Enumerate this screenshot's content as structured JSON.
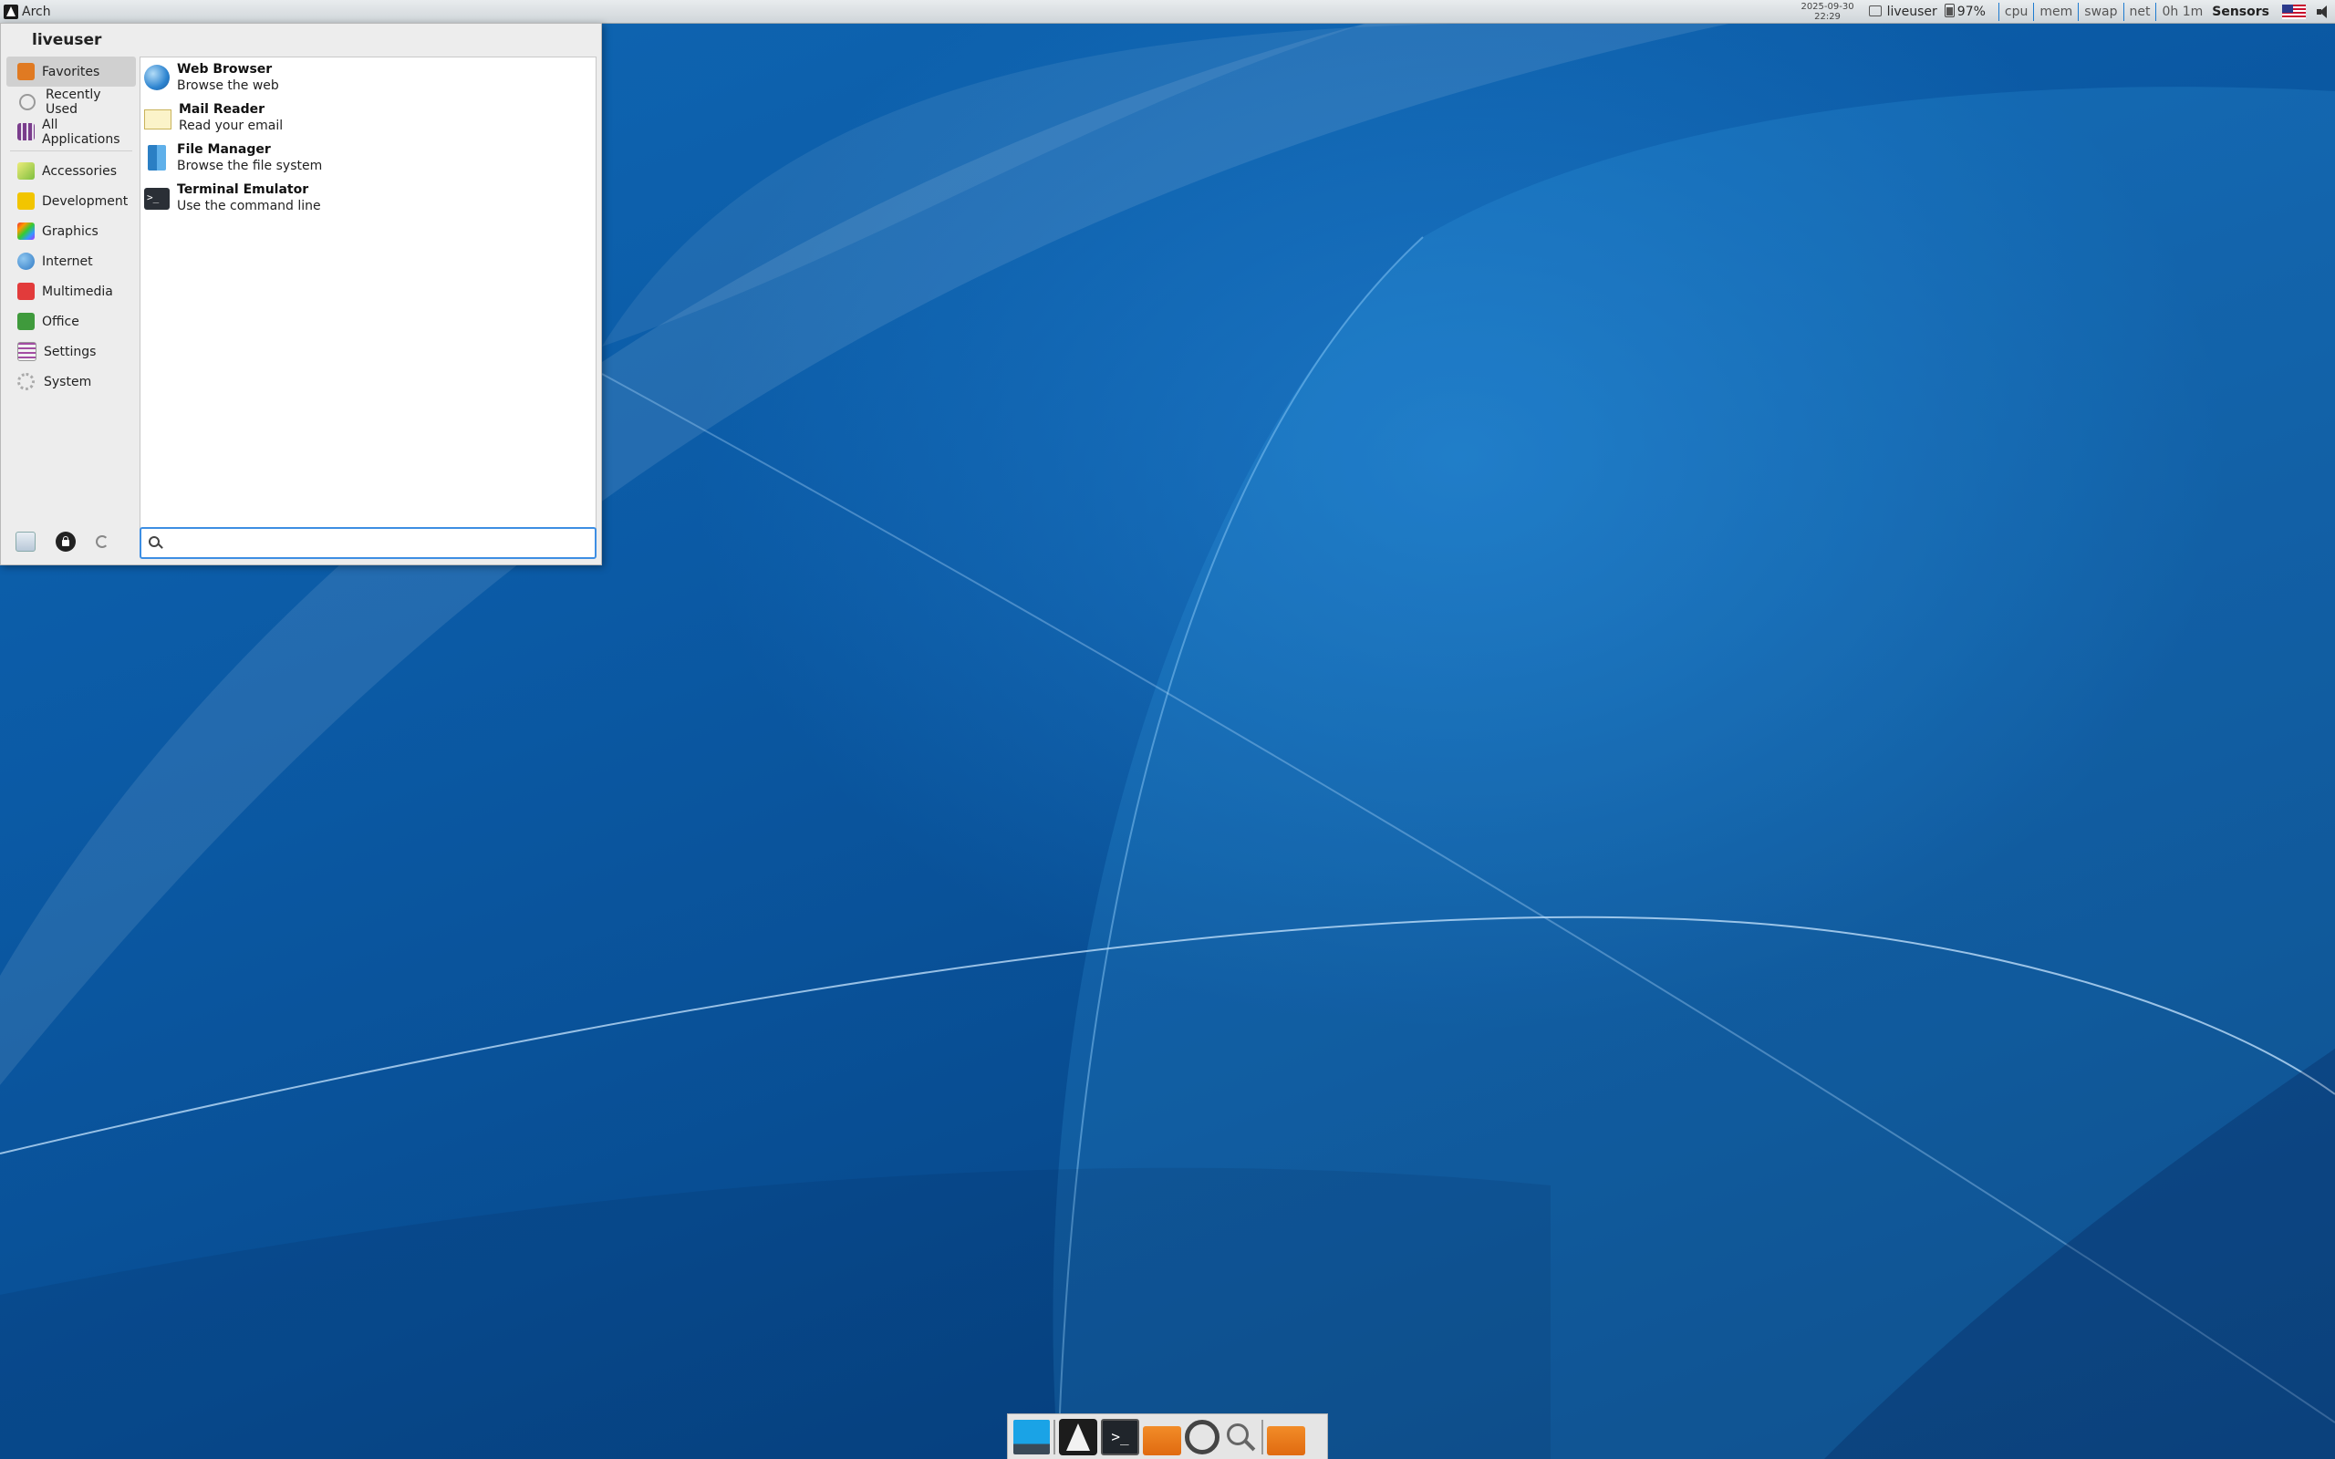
{
  "top_panel": {
    "menu_label": "Arch",
    "clock_date": "2025-09-30",
    "clock_time": "22:29",
    "user": "liveuser",
    "battery": "97%",
    "monitors": [
      "cpu",
      "mem",
      "swap",
      "net"
    ],
    "uptime": "0h 1m",
    "sensors": "Sensors"
  },
  "menu": {
    "username": "liveuser",
    "categories_top": [
      {
        "label": "Favorites",
        "icon": "favorites-icon",
        "active": true
      },
      {
        "label": "Recently Used",
        "icon": "clock-icon"
      },
      {
        "label": "All Applications",
        "icon": "grid-icon"
      }
    ],
    "categories": [
      {
        "label": "Accessories",
        "icon": "accessories-icon"
      },
      {
        "label": "Development",
        "icon": "development-icon"
      },
      {
        "label": "Graphics",
        "icon": "graphics-icon"
      },
      {
        "label": "Internet",
        "icon": "internet-icon"
      },
      {
        "label": "Multimedia",
        "icon": "multimedia-icon"
      },
      {
        "label": "Office",
        "icon": "office-icon"
      },
      {
        "label": "Settings",
        "icon": "settings-icon"
      },
      {
        "label": "System",
        "icon": "system-icon"
      }
    ],
    "apps": [
      {
        "name": "Web Browser",
        "desc": "Browse the web",
        "icon": "globe-icon"
      },
      {
        "name": "Mail Reader",
        "desc": "Read your email",
        "icon": "envelope-icon"
      },
      {
        "name": "File Manager",
        "desc": "Browse the file system",
        "icon": "file-manager-icon"
      },
      {
        "name": "Terminal Emulator",
        "desc": "Use the command line",
        "icon": "terminal-icon"
      }
    ],
    "search_value": ""
  },
  "dock": {
    "items": [
      "show-desktop-icon",
      "arch-icon",
      "terminal-icon",
      "folder-icon",
      "web-browser-icon",
      "search-icon",
      "folder-icon"
    ]
  }
}
